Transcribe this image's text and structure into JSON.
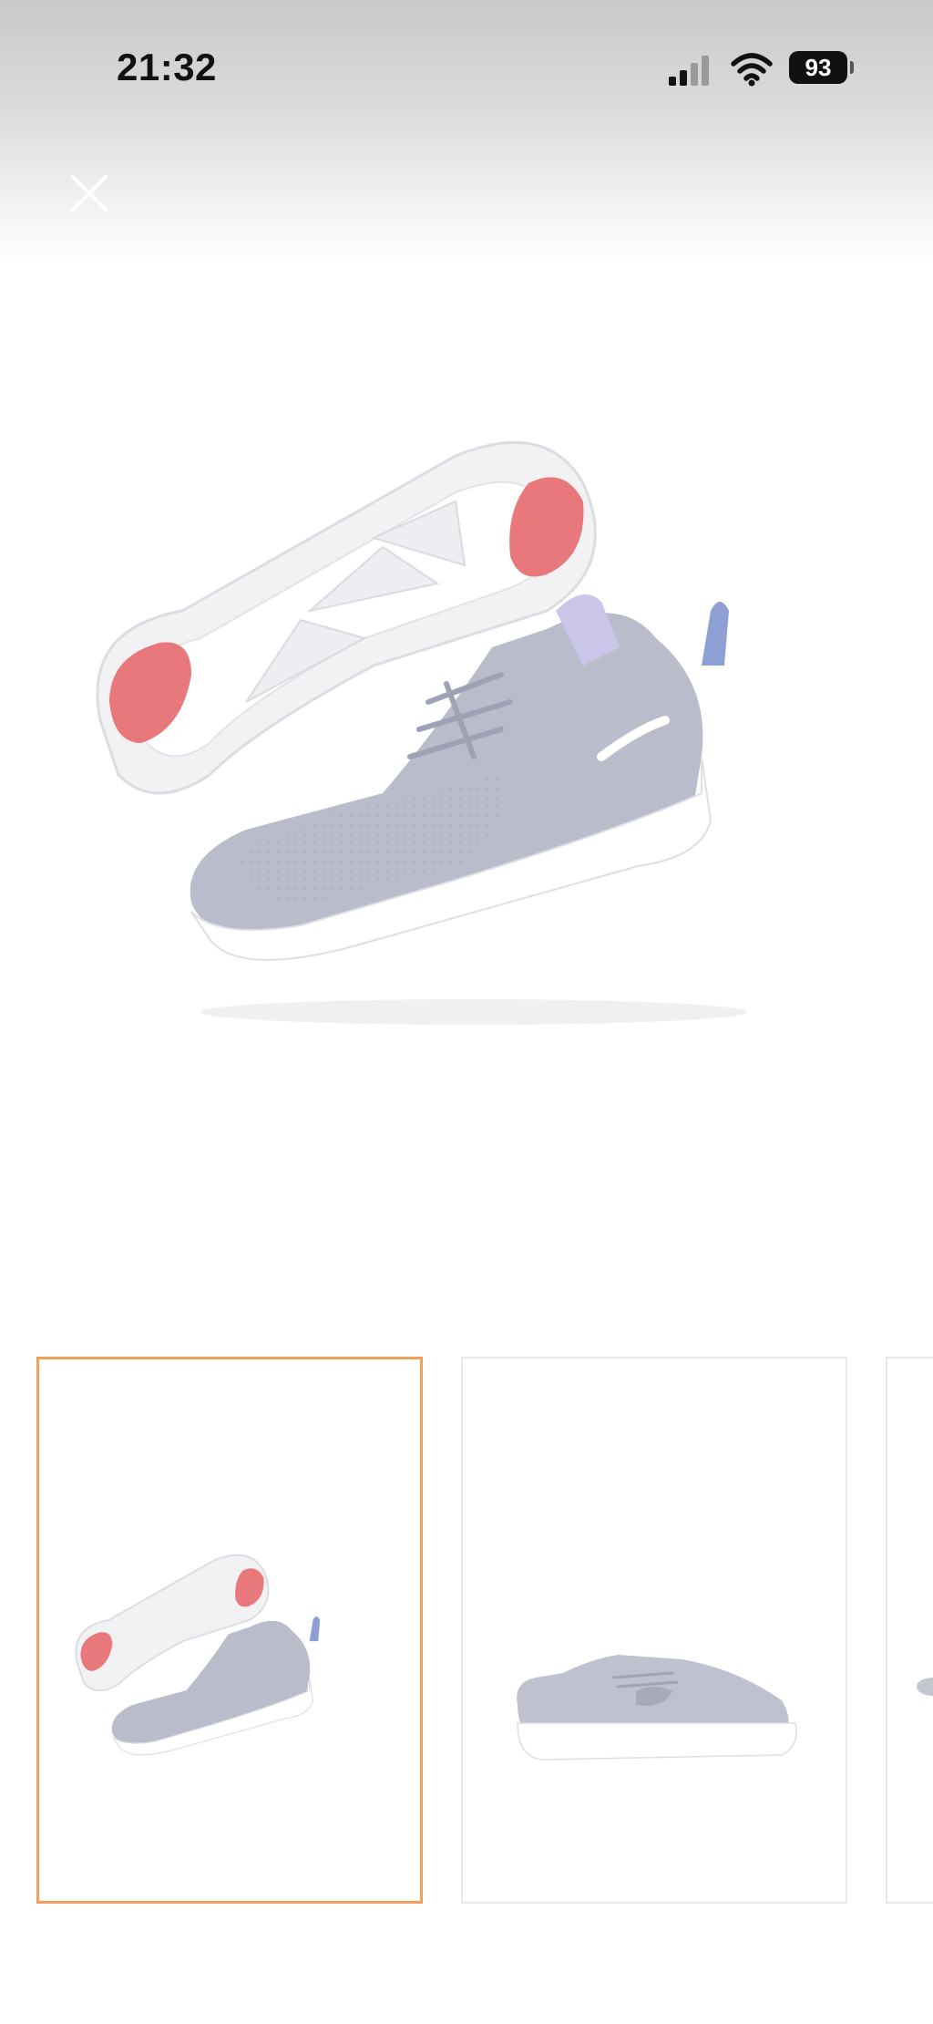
{
  "status_bar": {
    "time": "21:32",
    "battery_level": "93",
    "icons": [
      "signal-icon",
      "wifi-icon",
      "battery-icon"
    ]
  },
  "toolbar": {
    "close_icon": "close-icon"
  },
  "gallery": {
    "main_image": "sneaker-pair-photo",
    "selected_index": 0,
    "thumbnails": [
      {
        "name": "thumbnail-1",
        "image": "sneaker-pair-photo",
        "selected": true
      },
      {
        "name": "thumbnail-2",
        "image": "sneaker-side-photo",
        "selected": false
      },
      {
        "name": "thumbnail-3",
        "image": "sneaker-photo-partial",
        "selected": false
      }
    ]
  },
  "colors": {
    "selected_border": "#f0a05a",
    "thumb_border": "#e8e8ec",
    "shoe_upper": "#b9bdcb",
    "sole_accent": "#e8787c"
  }
}
